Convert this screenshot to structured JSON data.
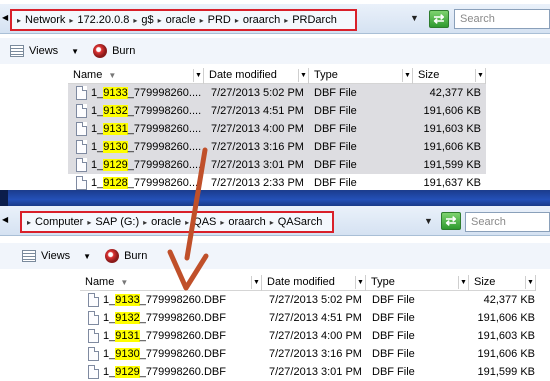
{
  "pane1": {
    "breadcrumb": [
      "Network",
      "172.20.0.8",
      "g$",
      "oracle",
      "PRD",
      "oraarch",
      "PRDarch"
    ],
    "search_placeholder": "Search",
    "toolbar": {
      "views": "Views",
      "burn": "Burn"
    },
    "columns": [
      "Name",
      "Date modified",
      "Type",
      "Size"
    ],
    "rows": [
      {
        "prefix": "1_",
        "seq": "9133",
        "rest": "_779998260....",
        "date": "7/27/2013 5:02 PM",
        "type": "DBF File",
        "size": "42,377 KB",
        "selected": true
      },
      {
        "prefix": "1_",
        "seq": "9132",
        "rest": "_779998260....",
        "date": "7/27/2013 4:51 PM",
        "type": "DBF File",
        "size": "191,606 KB",
        "selected": true
      },
      {
        "prefix": "1_",
        "seq": "9131",
        "rest": "_779998260....",
        "date": "7/27/2013 4:00 PM",
        "type": "DBF File",
        "size": "191,603 KB",
        "selected": true
      },
      {
        "prefix": "1_",
        "seq": "9130",
        "rest": "_779998260....",
        "date": "7/27/2013 3:16 PM",
        "type": "DBF File",
        "size": "191,606 KB",
        "selected": true
      },
      {
        "prefix": "1_",
        "seq": "9129",
        "rest": "_779998260....",
        "date": "7/27/2013 3:01 PM",
        "type": "DBF File",
        "size": "191,599 KB",
        "selected": true
      },
      {
        "prefix": "1_",
        "seq": "9128",
        "rest": "_779998260....",
        "date": "7/27/2013 2:33 PM",
        "type": "DBF File",
        "size": "191,637 KB",
        "selected": false
      }
    ]
  },
  "pane2": {
    "breadcrumb": [
      "Computer",
      "SAP (G:)",
      "oracle",
      "QAS",
      "oraarch",
      "QASarch"
    ],
    "search_placeholder": "Search",
    "toolbar": {
      "views": "Views",
      "burn": "Burn"
    },
    "columns": [
      "Name",
      "Date modified",
      "Type",
      "Size"
    ],
    "rows": [
      {
        "prefix": "1_",
        "seq": "9133",
        "rest": "_779998260.DBF",
        "date": "7/27/2013 5:02 PM",
        "type": "DBF File",
        "size": "42,377 KB"
      },
      {
        "prefix": "1_",
        "seq": "9132",
        "rest": "_779998260.DBF",
        "date": "7/27/2013 4:51 PM",
        "type": "DBF File",
        "size": "191,606 KB"
      },
      {
        "prefix": "1_",
        "seq": "9131",
        "rest": "_779998260.DBF",
        "date": "7/27/2013 4:00 PM",
        "type": "DBF File",
        "size": "191,603 KB"
      },
      {
        "prefix": "1_",
        "seq": "9130",
        "rest": "_779998260.DBF",
        "date": "7/27/2013 3:16 PM",
        "type": "DBF File",
        "size": "191,606 KB"
      },
      {
        "prefix": "1_",
        "seq": "9129",
        "rest": "_779998260.DBF",
        "date": "7/27/2013 3:01 PM",
        "type": "DBF File",
        "size": "191,599 KB"
      }
    ]
  },
  "colors": {
    "highlight_box": "#d9202a",
    "arrow": "#c0502a",
    "seq_highlight": "#ffff00",
    "selected_row": "#dddde1"
  },
  "icons": [
    "views-icon",
    "burn-icon",
    "refresh-icon",
    "file-icon",
    "sort-arrow-icon"
  ]
}
